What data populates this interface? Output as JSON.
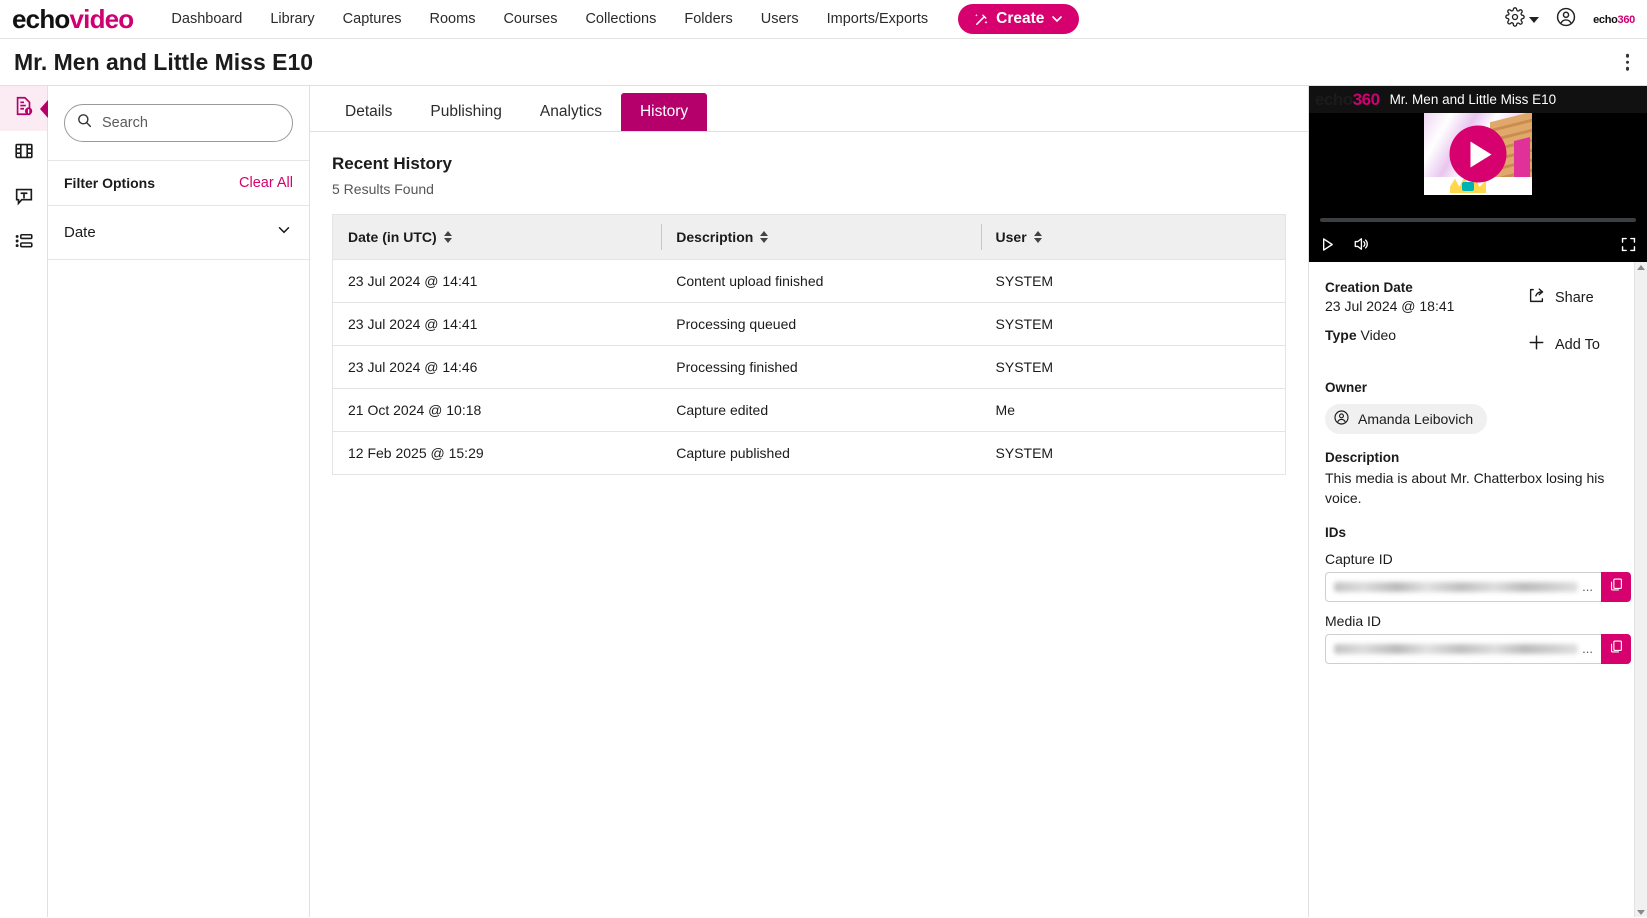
{
  "topnav": {
    "brand_echo": "echo",
    "brand_video": "video",
    "links": [
      {
        "label": "Dashboard"
      },
      {
        "label": "Library"
      },
      {
        "label": "Captures"
      },
      {
        "label": "Rooms"
      },
      {
        "label": "Courses"
      },
      {
        "label": "Collections"
      },
      {
        "label": "Folders"
      },
      {
        "label": "Users"
      },
      {
        "label": "Imports/Exports"
      }
    ],
    "create_label": "Create",
    "logo_echo": "echo",
    "logo_360": "360"
  },
  "titlebar": {
    "title": "Mr. Men and Little Miss E10"
  },
  "rail": {
    "items": [
      {
        "name": "media-info",
        "active": true
      },
      {
        "name": "media-frames",
        "active": false
      },
      {
        "name": "captions",
        "active": false
      },
      {
        "name": "playlist",
        "active": false
      }
    ]
  },
  "filters": {
    "search_placeholder": "Search",
    "search_value": "",
    "filter_options_label": "Filter Options",
    "clear_all_label": "Clear All",
    "groups": [
      {
        "label": "Date"
      }
    ]
  },
  "tabs": [
    {
      "label": "Details",
      "active": false
    },
    {
      "label": "Publishing",
      "active": false
    },
    {
      "label": "Analytics",
      "active": false
    },
    {
      "label": "History",
      "active": true
    }
  ],
  "history": {
    "heading": "Recent History",
    "results_text": "5 Results Found",
    "columns": [
      "Date (in UTC)",
      "Description",
      "User"
    ],
    "rows": [
      {
        "date": "23 Jul 2024 @ 14:41",
        "description": "Content upload finished",
        "user": "SYSTEM"
      },
      {
        "date": "23 Jul 2024 @ 14:41",
        "description": "Processing queued",
        "user": "SYSTEM"
      },
      {
        "date": "23 Jul 2024 @ 14:46",
        "description": "Processing finished",
        "user": "SYSTEM"
      },
      {
        "date": "21 Oct 2024 @ 10:18",
        "description": "Capture edited",
        "user": "Me"
      },
      {
        "date": "12 Feb 2025 @ 15:29",
        "description": "Capture published",
        "user": "SYSTEM"
      }
    ]
  },
  "player": {
    "logo_echo": "echo",
    "logo_360": "360",
    "title": "Mr. Men and Little Miss E10"
  },
  "details": {
    "creation_date_label": "Creation Date",
    "creation_date_value": "23 Jul 2024 @ 18:41",
    "type_label": "Type",
    "type_value": "Video",
    "owner_label": "Owner",
    "owner_value": "Amanda Leibovich",
    "description_label": "Description",
    "description_value": "This media is about Mr. Chatterbox losing his voice.",
    "ids_label": "IDs",
    "capture_id_label": "Capture ID",
    "capture_id_value": "",
    "capture_id_ellipsis": "...",
    "media_id_label": "Media ID",
    "media_id_value": "",
    "media_id_ellipsis": "...",
    "share_label": "Share",
    "add_to_label": "Add To"
  },
  "colors": {
    "brand_pink": "#d6006e",
    "tab_active": "#b5006b",
    "rail_active_bg": "#fbecf3",
    "header_bg": "#efefef"
  }
}
